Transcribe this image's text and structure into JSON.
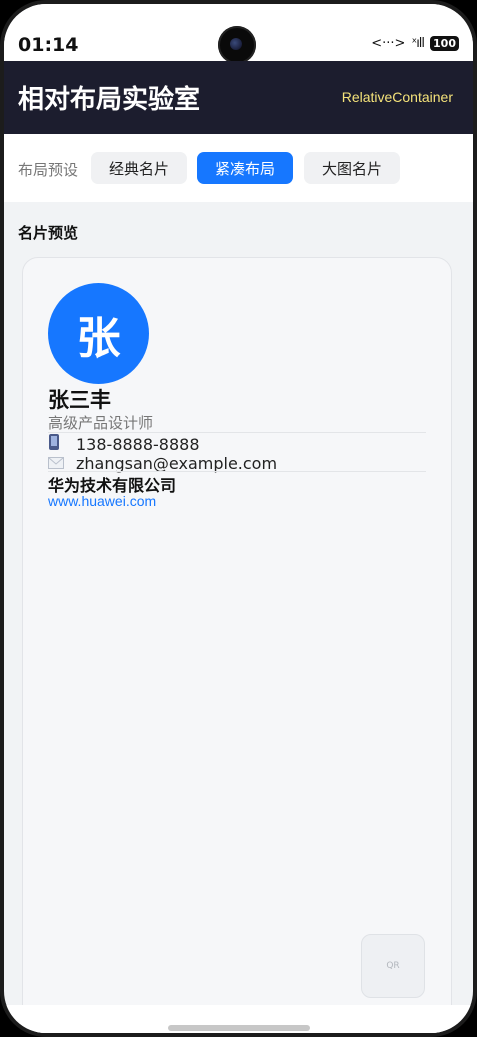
{
  "status_bar": {
    "time": "01:14",
    "network": "<···>",
    "signal": "ˣıll",
    "battery": "100"
  },
  "header": {
    "title": "相对布局实验室",
    "subtitle": "RelativeContainer"
  },
  "presets": {
    "label": "布局预设",
    "options": [
      "经典名片",
      "紧凑布局",
      "大图名片"
    ],
    "selected": "紧凑布局"
  },
  "preview": {
    "section_label": "名片预览",
    "avatar_char": "张",
    "name": "张三丰",
    "job_title": "高级产品设计师",
    "phone": "138-8888-8888",
    "email": "zhangsan@example.com",
    "company": "华为技术有限公司",
    "website": "www.huawei.com",
    "qr_label": "QR"
  },
  "colors": {
    "title_bar": "#1c1d2e",
    "accent": "#1677ff",
    "subtitle": "#f5e37a"
  }
}
